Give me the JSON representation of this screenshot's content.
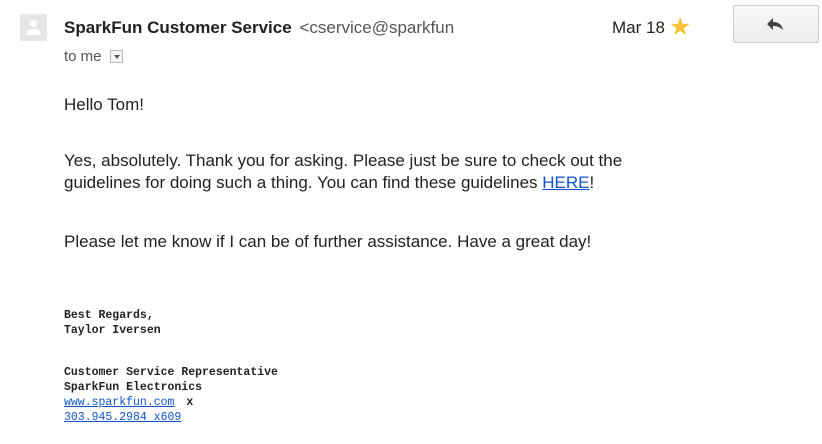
{
  "header": {
    "sender_name": "SparkFun Customer Service",
    "sender_email": "<cservice@sparkfun",
    "date": "Mar 18",
    "recipient": "to me"
  },
  "icons": {
    "avatar": "person-avatar-icon",
    "star": "star-icon",
    "reply": "reply-arrow-icon",
    "dropdown": "dropdown-caret-icon"
  },
  "colors": {
    "link": "#1155cc",
    "star": "#f8c33a",
    "text": "#222222"
  },
  "body": {
    "greeting": "Hello Tom!",
    "para1_line1": "Yes, absolutely. Thank you for asking. Please just be sure to check out the",
    "para1_line2": "guidelines for doing such a thing. You can find these guidelines ",
    "para1_link": "HERE",
    "para1_end": "!",
    "para2": "Please let me know if I can be of further assistance. Have a great day!"
  },
  "signature": {
    "closing": "Best Regards,",
    "name": "Taylor Iversen",
    "title": "Customer Service Representative",
    "company": "SparkFun Electronics",
    "website": "www.sparkfun.com",
    "website_suffix": "x",
    "phone": "303.945.2984 x609"
  }
}
